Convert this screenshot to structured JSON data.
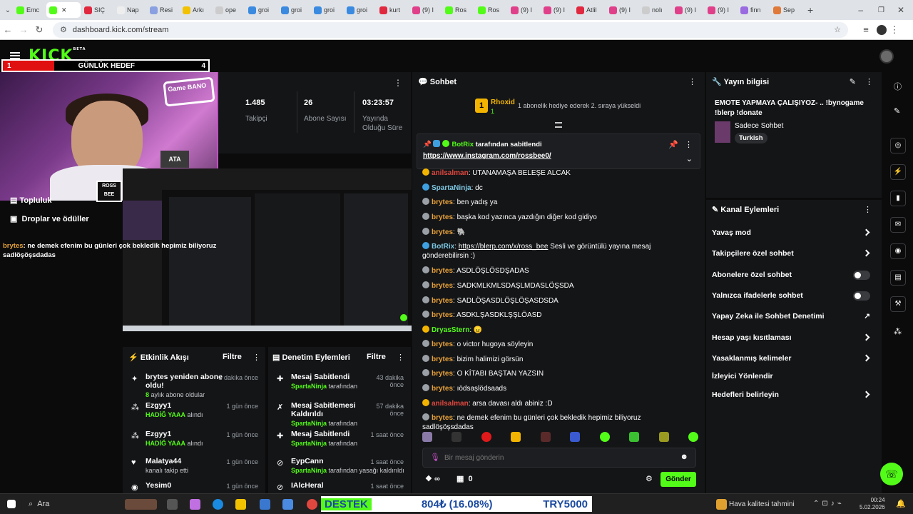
{
  "browser": {
    "tabs": [
      "Emc",
      "",
      "SIÇ",
      "Nap",
      "Resi",
      "Arkı",
      "ope",
      "groi",
      "groi",
      "groi",
      "groi",
      "kurt",
      "(9) I",
      "Ros",
      "Ros",
      "(9) I",
      "(9) I",
      "Atlil",
      "(9) I",
      "nolı",
      "(9) I",
      "(9) I",
      "finn",
      "Sep"
    ],
    "active_tab_index": 1,
    "url": "dashboard.kick.com/stream"
  },
  "goal": {
    "left": "1",
    "title": "GÜNLÜK HEDEF",
    "right": "4",
    "progress": 0.25
  },
  "webcam": {
    "clapper_text": "ROSS BEE",
    "sign_text": "Game BANO",
    "poster_text": "ATA"
  },
  "stats": [
    {
      "value": "1.485",
      "label": "Takipçi"
    },
    {
      "value": "26",
      "label": "Abone Sayısı"
    },
    {
      "value": "03:23:57",
      "label": "Yayında Olduğu Süre"
    }
  ],
  "sidebar": {
    "items": [
      {
        "label": "Topluluk"
      },
      {
        "label": "Droplar ve ödüller"
      }
    ],
    "overlay_msg_user": "brytes",
    "overlay_msg_text": ": ne demek efenim bu günleri çok bekledik hepimiz biliyoruz sadlöşöşsdadas"
  },
  "activity": {
    "title": "Etkinlik Akışı",
    "filter": "Filtre",
    "items": [
      {
        "name": "brytes yeniden abone oldu!",
        "sub_bold": "8",
        "sub": "aylık abone oldular",
        "time": "1 dakika önce"
      },
      {
        "name": "Ezgyy1",
        "sub_bold": "HADİĞ YAAA",
        "sub": "alındı",
        "time": "1 gün önce"
      },
      {
        "name": "Ezgyy1",
        "sub_bold": "HADİĞ YAAA",
        "sub": "alındı",
        "time": "1 gün önce"
      },
      {
        "name": "Malatya44",
        "sub_bold": "",
        "sub": "kanalı takip etti",
        "time": "1 gün önce"
      },
      {
        "name": "Yesim0",
        "sub_bold": "",
        "sub": "",
        "time": "1 gün önce"
      }
    ]
  },
  "moderation": {
    "title": "Denetim Eylemleri",
    "filter": "Filtre",
    "items": [
      {
        "name": "Mesaj Sabitlendi",
        "sub_bold": "SpartaNinja",
        "sub": "tarafından",
        "time": "43 dakika önce"
      },
      {
        "name": "Mesaj Sabitlemesi Kaldırıldı",
        "sub_bold": "SpartaNinja",
        "sub": "tarafından",
        "time": "57 dakika önce"
      },
      {
        "name": "Mesaj Sabitlendi",
        "sub_bold": "SpartaNinja",
        "sub": "tarafından",
        "time": "1 saat önce"
      },
      {
        "name": "EypCann",
        "sub_bold": "SpartaNinja",
        "sub": "tarafından yasağı kaldırıldı",
        "time": "1 saat önce"
      },
      {
        "name": "IAlcHeral",
        "sub_bold": "",
        "sub": "",
        "time": "1 saat önce"
      }
    ]
  },
  "chat": {
    "title": "Sohbet",
    "gift_user": "Rhoxid",
    "gift_count": "1",
    "gift_text": "1 abonelik hediye ederek 2. sıraya yükseldi",
    "pinned_by": "BotRix",
    "pinned_label": "tarafından sabitlendi",
    "pinned_link": "https://www.instagram.com/rossbee0/",
    "messages": [
      {
        "user": "anilsalman",
        "color": "#e0483f",
        "text": ": UTANAMAŞA BELEŞE ALCAK"
      },
      {
        "user": "SpartaNinja",
        "color": "#7ec8e3",
        "text": ": dc"
      },
      {
        "user": "brytes",
        "color": "#e8a23a",
        "text": ": ben yadış ya"
      },
      {
        "user": "brytes",
        "color": "#e8a23a",
        "text": ": başka kod yazınca yazdığın diğer kod gidiyo"
      },
      {
        "user": "brytes",
        "color": "#e8a23a",
        "text": ": 🐘"
      },
      {
        "user": "BotRix",
        "color": "#7ec8e3",
        "text": ": ",
        "link": "https://blerp.com/x/ross_bee",
        "after": " Sesli ve görüntülü yayına mesaj gönderebilirsin :)"
      },
      {
        "user": "brytes",
        "color": "#e8a23a",
        "text": ": ASDLÖŞLÖSDŞADAS"
      },
      {
        "user": "brytes",
        "color": "#e8a23a",
        "text": ": SADKMLKMLSDAŞLMDASLÖŞSDA"
      },
      {
        "user": "brytes",
        "color": "#e8a23a",
        "text": ": SADLÖŞASDLÖŞLÖŞASDSDA"
      },
      {
        "user": "brytes",
        "color": "#e8a23a",
        "text": ": ASDKLŞASDKLŞŞLÖASD"
      },
      {
        "user": "DryasStern",
        "color": "#53fc18",
        "text": ": 😠"
      },
      {
        "user": "brytes",
        "color": "#e8a23a",
        "text": ": o victor hugoya söyleyin"
      },
      {
        "user": "brytes",
        "color": "#e8a23a",
        "text": ": bizim halimizi görsün"
      },
      {
        "user": "brytes",
        "color": "#e8a23a",
        "text": ": O KİTABI BAŞTAN YAZSIN"
      },
      {
        "user": "brytes",
        "color": "#e8a23a",
        "text": ": ıödsaşlödsaads"
      },
      {
        "user": "anilsalman",
        "color": "#e0483f",
        "text": ": arsa davası aldı abiniz :D"
      },
      {
        "user": "brytes",
        "color": "#e8a23a",
        "text": ": ne demek efenim bu günleri çok bekledik hepimiz biliyoruz sadlöşöşsdadas"
      }
    ],
    "input_placeholder": "Bir mesaj gönderin",
    "send_label": "Gönder",
    "points": "0",
    "infinity": "∞"
  },
  "stream_info": {
    "title": "Yayın bilgisi",
    "stream_title": "EMOTE YAPMAYA ÇALIŞIYOZ- .. !bynogame !blerp !donate",
    "category": "Sadece Sohbet",
    "tag": "Turkish"
  },
  "channel_actions": {
    "title": "Kanal Eylemleri",
    "items": [
      {
        "label": "Yavaş mod",
        "kind": "chevron"
      },
      {
        "label": "Takipçilere özel sohbet",
        "kind": "chevron"
      },
      {
        "label": "Abonelere özel sohbet",
        "kind": "toggle"
      },
      {
        "label": "Yalnızca ifadelerle sohbet",
        "kind": "toggle"
      },
      {
        "label": "Yapay Zeka ile Sohbet Denetimi",
        "kind": "external"
      },
      {
        "label": "Hesap yaşı kısıtlaması",
        "kind": "chevron"
      },
      {
        "label": "Yasaklanmış kelimeler",
        "kind": "chevron"
      },
      {
        "label": "İzleyici Yönlendir",
        "kind": "none"
      },
      {
        "label": "Hedefleri belirleyin",
        "kind": "chevron"
      }
    ]
  },
  "taskbar": {
    "search": "Ara",
    "ticker_destek": "DESTEK",
    "ticker_amount": "804₺ (16.08%)",
    "ticker_goal": "TRY5000",
    "weather": "Hava kalitesi tahmini",
    "time": "00:24",
    "date": "5.02.2026"
  },
  "colors": {
    "kick_green": "#53fc18",
    "goal_red": "#e01010",
    "panel_bg": "#141517"
  }
}
